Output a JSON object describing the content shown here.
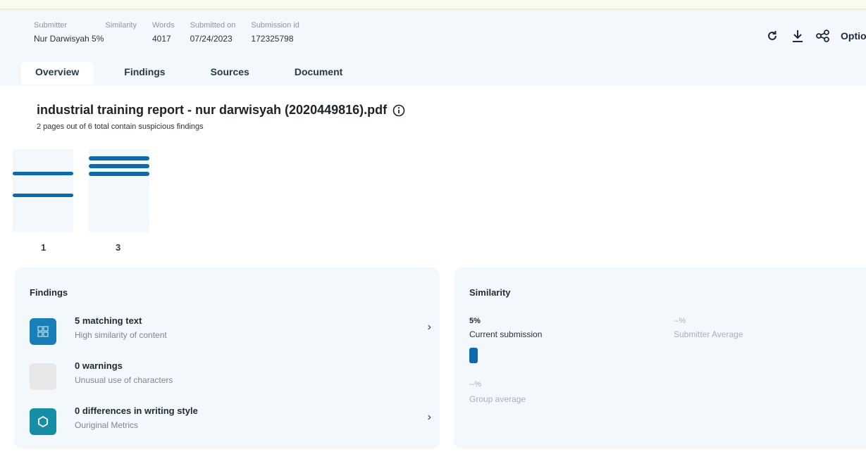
{
  "meta": {
    "submitter_label": "Submitter",
    "submitter_value": "Nur Darwisyah",
    "similarity_label": "Similarity",
    "similarity_value": "5%",
    "words_label": "Words",
    "words_value": "4017",
    "submitted_label": "Submitted on",
    "submitted_value": "07/24/2023",
    "submission_id_label": "Submission id",
    "submission_id_value": "172325798"
  },
  "toolbar": {
    "refresh_icon": "refresh-icon",
    "download_icon": "download-icon",
    "share_icon": "share-icon",
    "options_label": "Options"
  },
  "tabs": [
    {
      "label": "Overview",
      "active": true
    },
    {
      "label": "Findings"
    },
    {
      "label": "Sources"
    },
    {
      "label": "Document"
    }
  ],
  "document": {
    "title": "industrial training report - nur darwisyah (2020449816).pdf",
    "subtitle": "2 pages out of 6 total contain suspicious findings"
  },
  "thumbnails": [
    {
      "page": "1"
    },
    {
      "page": "3"
    }
  ],
  "findings": {
    "title": "Findings",
    "items": [
      {
        "title": "5 matching text",
        "subtitle": "High similarity of content",
        "icon": "grid-icon",
        "chevron": "›"
      },
      {
        "title": "0 warnings",
        "subtitle": "Unusual use of characters",
        "icon": "warning-icon"
      },
      {
        "title": "0 differences in writing style",
        "subtitle": "Ouriginal Metrics",
        "icon": "hexagon-icon",
        "chevron": "›"
      }
    ]
  },
  "similarity": {
    "title": "Similarity",
    "current_value": "5%",
    "current_label": "Current submission",
    "current_fraction": 0.05,
    "submitter_avg_value": "--%",
    "submitter_avg_label": "Submitter Average",
    "group_avg_value": "--%",
    "group_avg_label": "Group average"
  },
  "colors": {
    "accent": "#0e6aa8",
    "panel_bg": "#f2f8fb"
  }
}
